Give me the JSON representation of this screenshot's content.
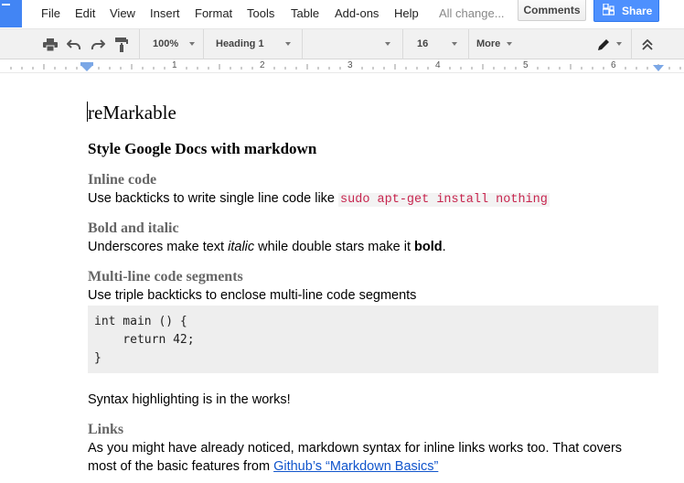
{
  "menubar": {
    "items": [
      "File",
      "Edit",
      "View",
      "Insert",
      "Format",
      "Tools",
      "Table",
      "Add-ons",
      "Help"
    ],
    "save_status": "All change...",
    "comments_label": "Comments",
    "share_label": "Share"
  },
  "toolbar": {
    "zoom": "100%",
    "style": "Heading 1",
    "font": "",
    "font_size": "16",
    "more_label": "More"
  },
  "ruler": {
    "numbers": [
      "1",
      "2",
      "3",
      "4",
      "5",
      "6"
    ]
  },
  "document": {
    "title": "reMarkable",
    "subtitle": "Style Google Docs with markdown",
    "inline_code": {
      "heading": "Inline code",
      "text": "Use backticks to write single line code like ",
      "code": "sudo apt-get install nothing"
    },
    "bold_italic": {
      "heading": "Bold and italic",
      "text_before": "Underscores make text ",
      "italic_word": "italic",
      "text_middle": " while double stars make it ",
      "bold_word": "bold",
      "text_after": "."
    },
    "multiline": {
      "heading": "Multi-line code segments",
      "text": "Use triple backticks to enclose multi-line code segments",
      "code_lines": [
        "int main () {",
        "    return 42;",
        "}"
      ]
    },
    "syntax_note": "Syntax highlighting is in the works!",
    "links": {
      "heading": "Links",
      "line1": "As you might have already noticed, markdown syntax for inline links works too. That covers",
      "line2_before": "most of the basic features from ",
      "link_text": "Github’s “Markdown Basics”"
    }
  }
}
